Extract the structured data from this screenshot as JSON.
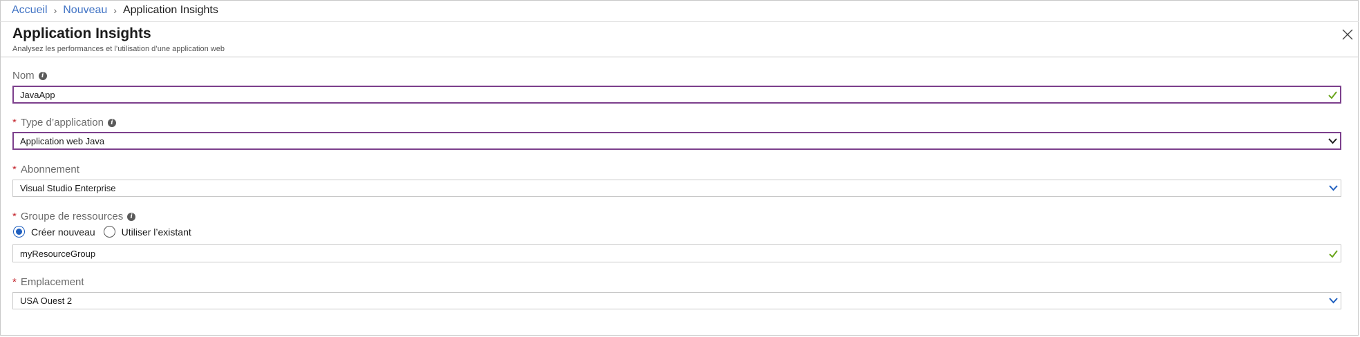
{
  "breadcrumb": {
    "items": [
      "Accueil",
      "Nouveau"
    ],
    "current": "Application Insights"
  },
  "header": {
    "title": "Application Insights",
    "subtitle": "Analysez les performances et l’utilisation d’une application web"
  },
  "form": {
    "name": {
      "label": "Nom",
      "value": "JavaApp",
      "status_icon": "check-icon"
    },
    "app_type": {
      "required": "*",
      "label": "Type d’application",
      "value": "Application web Java",
      "icon": "chevron-down-icon"
    },
    "subscription": {
      "required": "*",
      "label": "Abonnement",
      "value": "Visual Studio Enterprise",
      "icon": "chevron-down-icon"
    },
    "resource_group": {
      "required": "*",
      "label": "Groupe de ressources",
      "options": [
        "Créer nouveau",
        "Utiliser l’existant"
      ],
      "selected_option": "Créer nouveau",
      "value": "myResourceGroup",
      "status_icon": "check-icon"
    },
    "location": {
      "required": "*",
      "label": "Emplacement",
      "value": "USA Ouest 2",
      "icon": "chevron-down-icon"
    }
  },
  "colors": {
    "link": "#3f72c4",
    "required": "#c4262e",
    "focus_border": "#7c3f8c",
    "check": "#6aa51c",
    "accent": "#1f5fbf"
  }
}
